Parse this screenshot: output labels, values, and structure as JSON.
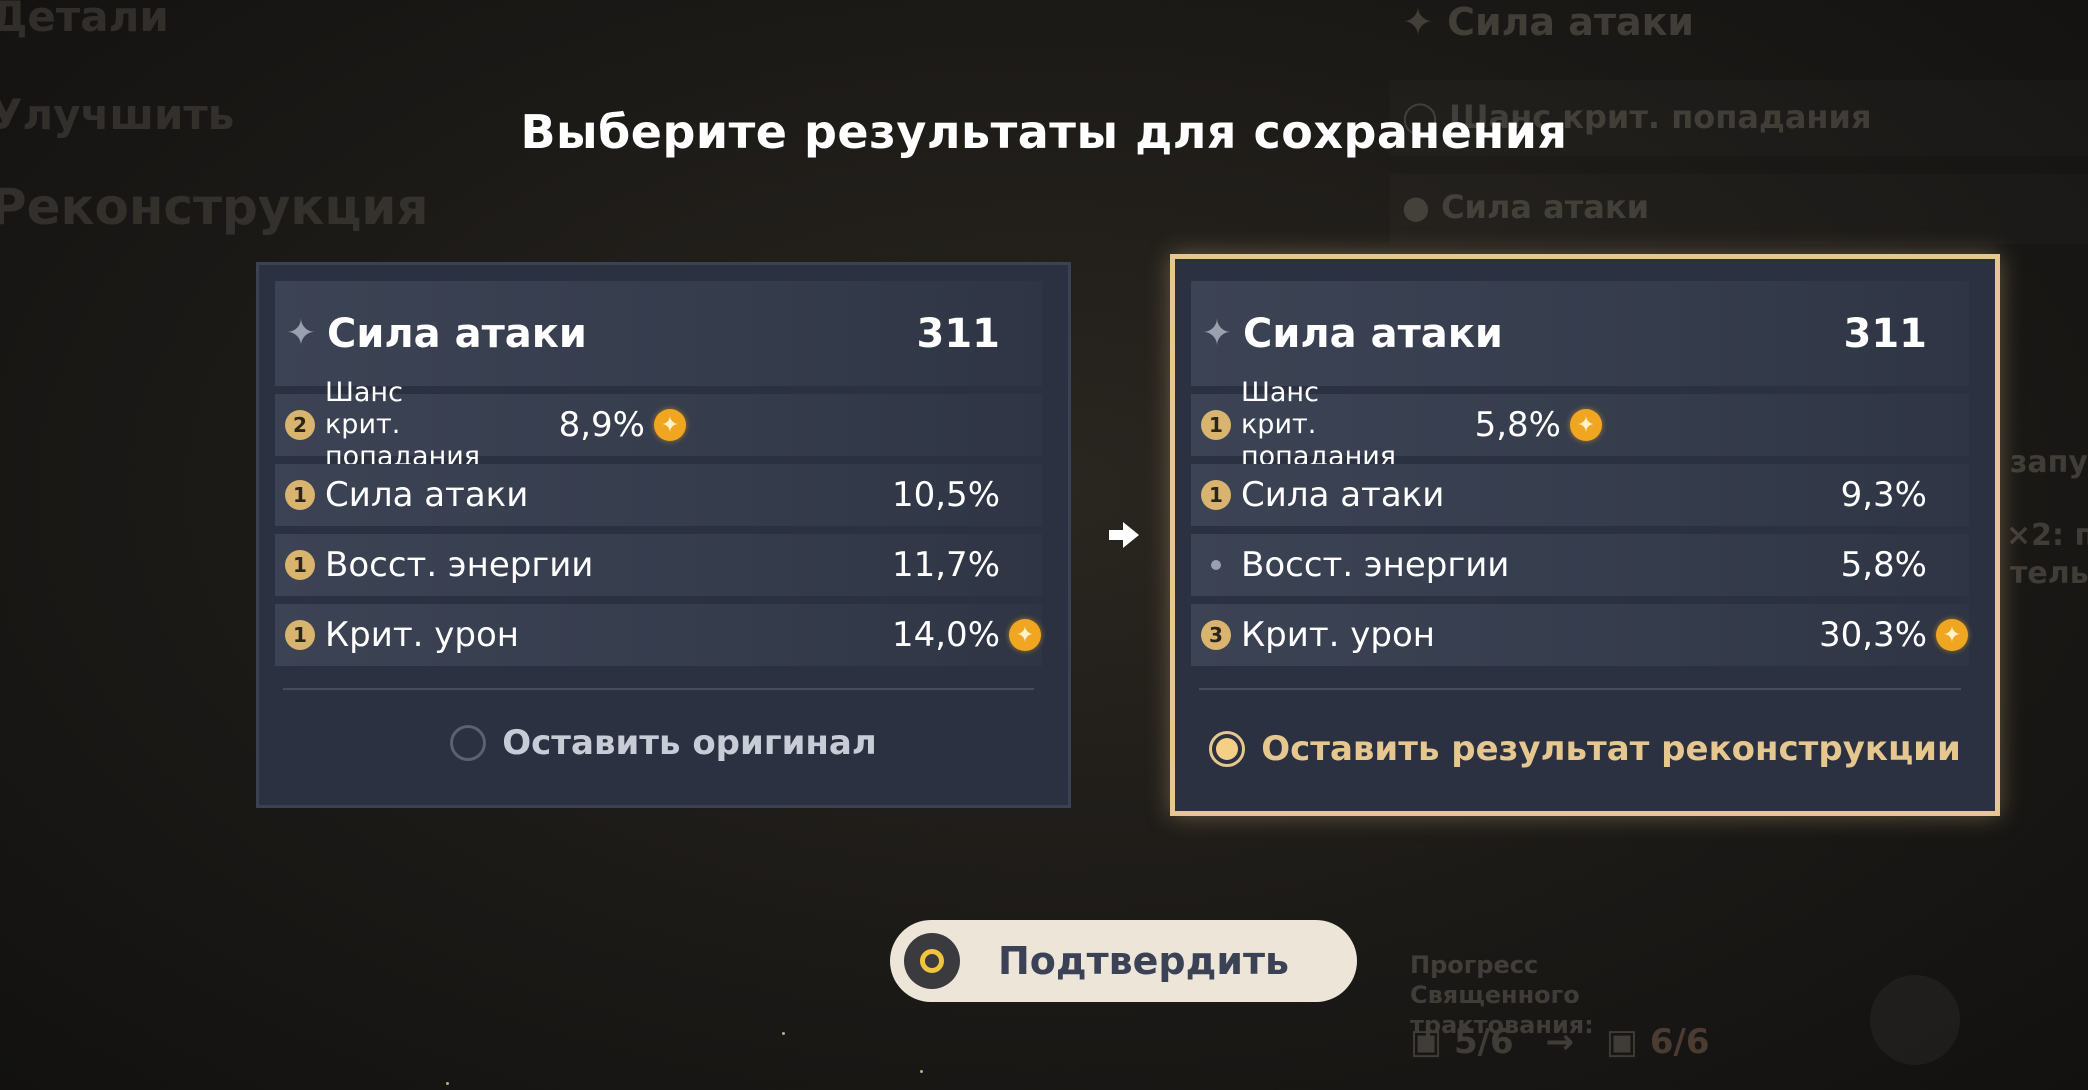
{
  "background_menu": {
    "left_items": [
      "Детали",
      "Улучшить",
      "Реконструкция"
    ],
    "right_items": [
      "Сила атаки",
      "Шанс крит. попадания",
      "Сила атаки"
    ],
    "right_side_text": [
      "запу",
      "×2: п",
      "тельн"
    ],
    "progress_label": "Прогресс Священного трактования:",
    "progress_from": "5/6",
    "progress_to": "6/6"
  },
  "title": "Выберите результаты для сохранения",
  "original": {
    "main_stat": {
      "name": "Сила атаки",
      "value": "311"
    },
    "substats": [
      {
        "roll": "2",
        "name": "Шанс крит. попадания",
        "value": "8,9%",
        "highlight": true
      },
      {
        "roll": "1",
        "name": "Сила атаки",
        "value": "10,5%",
        "highlight": false
      },
      {
        "roll": "1",
        "name": "Восст. энергии",
        "value": "11,7%",
        "highlight": false
      },
      {
        "roll": "1",
        "name": "Крит. урон",
        "value": "14,0%",
        "highlight": true
      }
    ],
    "choice_label": "Оставить оригинал",
    "selected": false
  },
  "reconstructed": {
    "main_stat": {
      "name": "Сила атаки",
      "value": "311"
    },
    "substats": [
      {
        "roll": "1",
        "name": "Шанс крит. попадания",
        "value": "5,8%",
        "highlight": true
      },
      {
        "roll": "1",
        "name": "Сила атаки",
        "value": "9,3%",
        "highlight": false
      },
      {
        "roll": "",
        "name": "Восст. энергии",
        "value": "5,8%",
        "highlight": false
      },
      {
        "roll": "3",
        "name": "Крит. урон",
        "value": "30,3%",
        "highlight": true
      }
    ],
    "choice_label": "Оставить результат реконструкции",
    "selected": true
  },
  "confirm_button": {
    "label": "Подтвердить"
  },
  "colors": {
    "accent_gold": "#e6c78f",
    "card_bg": "#2b3140",
    "highlight_star": "#f0a620"
  }
}
